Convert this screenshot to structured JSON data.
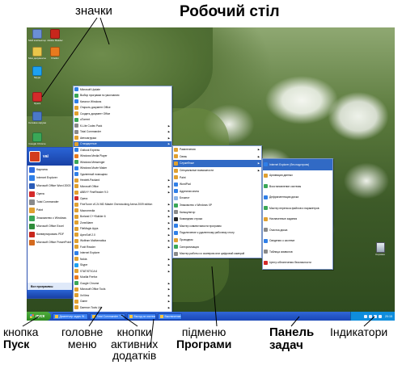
{
  "annotations": {
    "icons": "значки",
    "desktop": "Робочий стіл",
    "start_line1": "кнопка",
    "start_line2": "Пуск",
    "menu_line1": "головне",
    "menu_line2": "меню",
    "apps_line1": "кнопки",
    "apps_line2": "активних",
    "apps_line3": "додатків",
    "sub_line1": "підменю",
    "sub_line2": "Програми",
    "taskbar_line1": "Панель",
    "taskbar_line2": "задач",
    "indicators": "Індикатори"
  },
  "desktop_icons": [
    {
      "label": "Мой компьютер",
      "color": "#6b8fd6"
    },
    {
      "label": "Adobe Reader",
      "color": "#c8261c"
    },
    {
      "label": "Мои документы",
      "color": "#e9c54a"
    },
    {
      "label": "Firefox",
      "color": "#e87a1e"
    },
    {
      "label": "Skype",
      "color": "#1da1f2"
    },
    {
      "label": "Opera",
      "color": "#d42a2a"
    },
    {
      "label": "Сетевое окружение",
      "color": "#4a78c8"
    },
    {
      "label": "Google Chrome",
      "color": "#3aa757"
    }
  ],
  "start_menu": {
    "user": "vai",
    "items": [
      {
        "label": "Карлина",
        "color": "#2d6be0"
      },
      {
        "label": "Internet Explorer",
        "color": "#2f7fe8"
      },
      {
        "label": "Microsoft Office Word 2003",
        "color": "#2b5cb8"
      },
      {
        "label": "Opera",
        "color": "#d42a2a"
      },
      {
        "label": "Total Commander",
        "color": "#8a8a8a"
      },
      {
        "label": "Paint",
        "color": "#e0a030"
      },
      {
        "label": "Знакомство с Windows",
        "color": "#3aa757"
      },
      {
        "label": "Microsoft Office Excel",
        "color": "#2e8b3a"
      },
      {
        "label": "Конвертировать PDF",
        "color": "#c8261c"
      },
      {
        "label": "Microsoft Office PowerPoint 2003",
        "color": "#d46a1e"
      }
    ],
    "all_programs": "Все программы"
  },
  "programs_menu": [
    {
      "label": "Microsoft Update",
      "color": "#2f7fe8",
      "arrow": false
    },
    {
      "label": "Выбор программ по умолчанию",
      "color": "#3aa757",
      "arrow": false
    },
    {
      "label": "Каталог Windows",
      "color": "#2f7fe8",
      "arrow": false
    },
    {
      "label": "Открыть документ Office",
      "color": "#e0a030",
      "arrow": false
    },
    {
      "label": "Создать документ Office",
      "color": "#e0a030",
      "arrow": false
    },
    {
      "label": "uTorrent",
      "color": "#3aa757",
      "arrow": false
    },
    {
      "label": "K-Lite Codec Pack",
      "color": "#8a8a8a",
      "arrow": true
    },
    {
      "label": "Total Commander",
      "color": "#8a8a8a",
      "arrow": true
    },
    {
      "label": "Автозагрузка",
      "color": "#e0a030",
      "arrow": true
    },
    {
      "label": "Стандартные",
      "color": "#e0a030",
      "arrow": true,
      "selected": true
    },
    {
      "label": "Outlook Express",
      "color": "#2f7fe8",
      "arrow": false
    },
    {
      "label": "Windows Media Player",
      "color": "#e87a1e",
      "arrow": false
    },
    {
      "label": "Windows Messenger",
      "color": "#3aa757",
      "arrow": false
    },
    {
      "label": "Windows Movie Maker",
      "color": "#2f7fe8",
      "arrow": false
    },
    {
      "label": "Удаленный помощник",
      "color": "#2f7fe8",
      "arrow": false
    },
    {
      "label": "Hewlett-Packard",
      "color": "#e0a030",
      "arrow": true
    },
    {
      "label": "Microsoft Office",
      "color": "#e0a030",
      "arrow": true
    },
    {
      "label": "ABBYY FineReader 9.0",
      "color": "#e0a030",
      "arrow": true
    },
    {
      "label": "Opera",
      "color": "#d42a2a",
      "arrow": false
    },
    {
      "label": "FineTuner v0.24 MD Master Overclocking Arena 2009 edition",
      "color": "#e0a030",
      "arrow": true
    },
    {
      "label": "Macromedia",
      "color": "#e0a030",
      "arrow": true
    },
    {
      "label": "Borland C++Builder 6",
      "color": "#e0a030",
      "arrow": true
    },
    {
      "label": "ZoneAlarm",
      "color": "#e0a030",
      "arrow": true
    },
    {
      "label": "FileMagic Apps",
      "color": "#e0a030",
      "arrow": true
    },
    {
      "label": "ApexSoft 2.0",
      "color": "#e0a030",
      "arrow": true
    },
    {
      "label": "Wolfram Mathematica",
      "color": "#e0a030",
      "arrow": true
    },
    {
      "label": "Foxit Reader",
      "color": "#e0a030",
      "arrow": true
    },
    {
      "label": "Internet Explorer",
      "color": "#2f7fe8",
      "arrow": false
    },
    {
      "label": "Nokia",
      "color": "#e0a030",
      "arrow": true
    },
    {
      "label": "Skype",
      "color": "#1da1f2",
      "arrow": true
    },
    {
      "label": "STATISTICA 6",
      "color": "#e0a030",
      "arrow": true
    },
    {
      "label": "Mozilla Firefox",
      "color": "#e87a1e",
      "arrow": false
    },
    {
      "label": "Google Chrome",
      "color": "#3aa757",
      "arrow": true
    },
    {
      "label": "Microsoft Office Tools",
      "color": "#e0a030",
      "arrow": true
    },
    {
      "label": "XnView",
      "color": "#e0a030",
      "arrow": true
    },
    {
      "label": "Game",
      "color": "#e0a030",
      "arrow": true
    },
    {
      "label": "Daemon Tools Lite",
      "color": "#e0a030",
      "arrow": true
    },
    {
      "label": "ox_map",
      "color": "#e0a030",
      "arrow": true
    }
  ],
  "tools_menu": [
    {
      "label": "Развлечения",
      "color": "#e0a030",
      "arrow": true
    },
    {
      "label": "Связь",
      "color": "#e0a030",
      "arrow": true
    },
    {
      "label": "Служебные",
      "color": "#e0a030",
      "arrow": true,
      "selected": true
    },
    {
      "label": "Специальные возможности",
      "color": "#e0a030",
      "arrow": true
    },
    {
      "label": "Paint",
      "color": "#e0a030",
      "arrow": false
    },
    {
      "label": "WordPad",
      "color": "#2f7fe8",
      "arrow": false
    },
    {
      "label": "Адресная книга",
      "color": "#2f7fe8",
      "arrow": false
    },
    {
      "label": "Блокнот",
      "color": "#8ab4e8",
      "arrow": false
    },
    {
      "label": "Знакомство с Windows XP",
      "color": "#3aa757",
      "arrow": false
    },
    {
      "label": "Калькулятор",
      "color": "#8a8a8a",
      "arrow": false
    },
    {
      "label": "Командная строка",
      "color": "#222222",
      "arrow": false
    },
    {
      "label": "Мастер совместимости программ",
      "color": "#2f7fe8",
      "arrow": false
    },
    {
      "label": "Подключение к удаленному рабочему столу",
      "color": "#2f7fe8",
      "arrow": false
    },
    {
      "label": "Проводник",
      "color": "#e0a030",
      "arrow": false
    },
    {
      "label": "Синхронизация",
      "color": "#3aa757",
      "arrow": false
    },
    {
      "label": "Мастер работы со сканером или цифровой камерой",
      "color": "#8a8a8a",
      "arrow": false
    }
  ],
  "system_menu": [
    {
      "label": "Internet Explorer (без надстроек)",
      "color": "#2f7fe8",
      "selected": true
    },
    {
      "label": "Архивация данных",
      "color": "#e0a030"
    },
    {
      "label": "Восстановление системы",
      "color": "#3aa757"
    },
    {
      "label": "Дефрагментация диска",
      "color": "#2f7fe8"
    },
    {
      "label": "Мастер переноса файлов и параметров",
      "color": "#3aa757"
    },
    {
      "label": "Назначенные задания",
      "color": "#e0a030"
    },
    {
      "label": "Очистка диска",
      "color": "#8a8a8a"
    },
    {
      "label": "Сведения о системе",
      "color": "#2f7fe8"
    },
    {
      "label": "Таблица символов",
      "color": "#8a8a8a"
    },
    {
      "label": "Центр обеспечения безопасности",
      "color": "#d42a2a"
    }
  ],
  "taskbar": {
    "start_label": "пуск",
    "apps": [
      {
        "label": "Диспетчер задач W..."
      },
      {
        "label": "Total Commander 7.0..."
      },
      {
        "label": "Выход из системы"
      },
      {
        "label": "Выключение"
      }
    ],
    "clock": "20:15"
  },
  "recycle_bin": "Корзина"
}
